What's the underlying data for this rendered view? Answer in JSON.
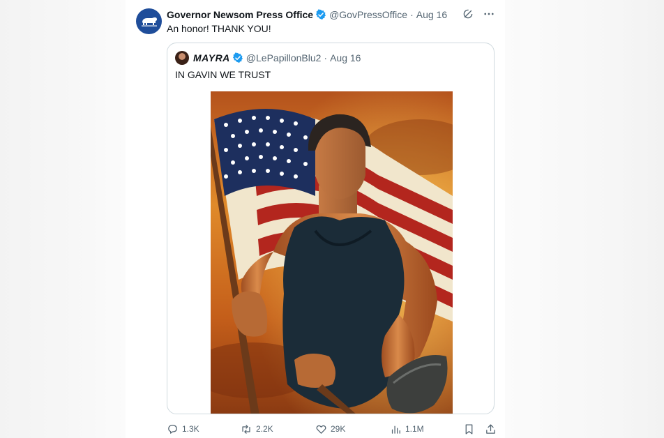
{
  "tweet": {
    "author_name": "Governor Newsom Press Office",
    "handle": "@GovPressOffice",
    "separator": "·",
    "date": "Aug 16",
    "text": "An honor! THANK YOU!"
  },
  "quote": {
    "author_name": "MAYRA",
    "handle": "@LePapillonBlu2",
    "separator": "·",
    "date": "Aug 16",
    "text": "IN GAVIN WE TRUST"
  },
  "actions": {
    "replies": "1.3K",
    "reposts": "2.2K",
    "likes": "29K",
    "views": "1.1M"
  },
  "colors": {
    "accent": "#1d9bf0",
    "verified": "#1d9bf0",
    "text_secondary": "#536471",
    "avatar_bg": "#1f4d9a"
  },
  "icons": [
    "grok-icon",
    "more-icon",
    "reply-icon",
    "repost-icon",
    "like-icon",
    "views-icon",
    "bookmark-icon",
    "share-icon",
    "verified-badge-icon",
    "bear-logo-icon"
  ]
}
